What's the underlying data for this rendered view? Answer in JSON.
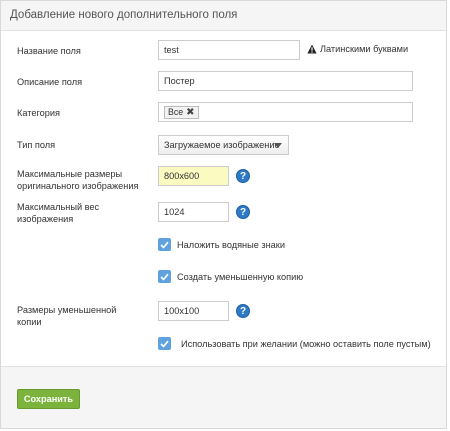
{
  "panel": {
    "title": "Добавление нового дополнительного поля"
  },
  "form": {
    "field_name": {
      "label": "Название поля",
      "value": "test",
      "hint": "Латинскими буквами"
    },
    "field_description": {
      "label": "Описание поля",
      "value": "Постер"
    },
    "category": {
      "label": "Категория",
      "tag": "Все"
    },
    "field_type": {
      "label": "Тип поля",
      "selected": "Загружаемое изображение"
    },
    "max_size": {
      "label_line1": "Максимальные размеры",
      "label_line2": "оригинального изображения",
      "value": "800x600"
    },
    "max_weight": {
      "label_line1": "Максимальный вес",
      "label_line2": "изображения",
      "value": "1024"
    },
    "watermark": {
      "label": "Наложить водяные знаки",
      "checked": true
    },
    "thumbnail": {
      "label": "Создать уменьшенную копию",
      "checked": true
    },
    "thumb_size": {
      "label_line1": "Размеры уменьшенной",
      "label_line2": "копии",
      "value": "100x100"
    },
    "optional": {
      "label": "Использовать при желании (можно оставить поле пустым)",
      "checked": true
    }
  },
  "help_icon_text": "?",
  "footer": {
    "save_label": "Сохранить"
  },
  "colors": {
    "accent": "#2e7ac6",
    "save_green": "#7bb33d",
    "checkbox": "#5fa2dd",
    "highlight": "#fbfac1"
  }
}
